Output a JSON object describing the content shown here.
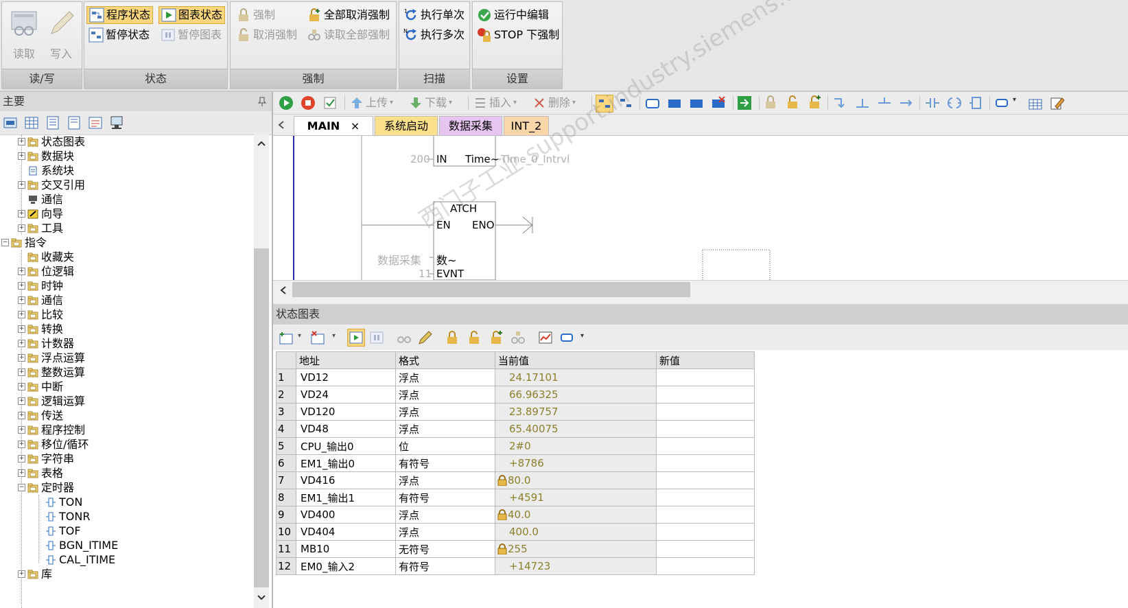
{
  "ribbon": {
    "groups": {
      "rw": "读/写",
      "status": "状态",
      "force": "强制",
      "scan": "扫描",
      "settings": "设置"
    },
    "read": "读取",
    "write": "写入",
    "program_status": "程序状态",
    "chart_status": "图表状态",
    "pause_status": "暂停状态",
    "pause_chart": "暂停图表",
    "force": "强制",
    "unforce": "取消强制",
    "unforce_all": "全部取消强制",
    "read_all_forced": "读取全部强制",
    "single_scan": "执行单次",
    "multiple_scans": "执行多次",
    "run_edit": "运行中编辑",
    "stop_force": "STOP 下强制"
  },
  "left_panel": {
    "title": "主要",
    "pin": "ᵖ",
    "tree": [
      {
        "label": "状态图表",
        "exp": "+"
      },
      {
        "label": "数据块",
        "exp": "+"
      },
      {
        "label": "系统块",
        "exp": ""
      },
      {
        "label": "交叉引用",
        "exp": "+"
      },
      {
        "label": "通信",
        "exp": ""
      },
      {
        "label": "向导",
        "exp": "+"
      },
      {
        "label": "工具",
        "exp": "+"
      },
      {
        "label": "指令",
        "exp": "-"
      },
      {
        "label": "收藏夹",
        "exp": ""
      },
      {
        "label": "位逻辑",
        "exp": "+"
      },
      {
        "label": "时钟",
        "exp": "+"
      },
      {
        "label": "通信",
        "exp": "+"
      },
      {
        "label": "比较",
        "exp": "+"
      },
      {
        "label": "转换",
        "exp": "+"
      },
      {
        "label": "计数器",
        "exp": "+"
      },
      {
        "label": "浮点运算",
        "exp": "+"
      },
      {
        "label": "整数运算",
        "exp": "+"
      },
      {
        "label": "中断",
        "exp": "+"
      },
      {
        "label": "逻辑运算",
        "exp": "+"
      },
      {
        "label": "传送",
        "exp": "+"
      },
      {
        "label": "程序控制",
        "exp": "+"
      },
      {
        "label": "移位/循环",
        "exp": "+"
      },
      {
        "label": "字符串",
        "exp": "+"
      },
      {
        "label": "表格",
        "exp": "+"
      },
      {
        "label": "定时器",
        "exp": "-"
      },
      {
        "label": "TON",
        "exp": ""
      },
      {
        "label": "TONR",
        "exp": ""
      },
      {
        "label": "TOF",
        "exp": ""
      },
      {
        "label": "BGN_ITIME",
        "exp": ""
      },
      {
        "label": "CAL_ITIME",
        "exp": ""
      },
      {
        "label": "库",
        "exp": "+"
      }
    ]
  },
  "editor": {
    "toolbar": {
      "upload": "上传",
      "download": "下载",
      "insert": "插入",
      "delete": "删除"
    },
    "tabs": [
      "MAIN",
      "系统启动",
      "数据采集",
      "INT_2"
    ],
    "tab_close": "×",
    "ladder": {
      "in_value": "200",
      "in_pin": "IN",
      "time_pin": "Time~",
      "time_out": "Time_0_Intrvl",
      "atch_title": "ATCH",
      "en": "EN",
      "eno": "ENO",
      "int_label": "数据采集",
      "int_pin": "数~",
      "evnt_value": "11",
      "evnt_pin": "EVNT"
    }
  },
  "status_chart": {
    "title": "状态图表",
    "columns": [
      "地址",
      "格式",
      "当前值",
      "新值"
    ],
    "rows": [
      {
        "n": "1",
        "addr": "VD12",
        "fmt": "浮点",
        "cur": "24.17101",
        "forced": false
      },
      {
        "n": "2",
        "addr": "VD24",
        "fmt": "浮点",
        "cur": "66.96325",
        "forced": false
      },
      {
        "n": "3",
        "addr": "VD120",
        "fmt": "浮点",
        "cur": "23.89757",
        "forced": false
      },
      {
        "n": "4",
        "addr": "VD48",
        "fmt": "浮点",
        "cur": "65.40075",
        "forced": false
      },
      {
        "n": "5",
        "addr": "CPU_输出0",
        "fmt": "位",
        "cur": "2#0",
        "forced": false
      },
      {
        "n": "6",
        "addr": "EM1_输出0",
        "fmt": "有符号",
        "cur": "+8786",
        "forced": false
      },
      {
        "n": "7",
        "addr": "VD416",
        "fmt": "浮点",
        "cur": "80.0",
        "forced": true
      },
      {
        "n": "8",
        "addr": "EM1_输出1",
        "fmt": "有符号",
        "cur": "+4591",
        "forced": false
      },
      {
        "n": "9",
        "addr": "VD400",
        "fmt": "浮点",
        "cur": "40.0",
        "forced": true
      },
      {
        "n": "10",
        "addr": "VD404",
        "fmt": "浮点",
        "cur": "400.0",
        "forced": false
      },
      {
        "n": "11",
        "addr": "MB10",
        "fmt": "无符号",
        "cur": "255",
        "forced": true
      },
      {
        "n": "12",
        "addr": "EM0_输入2",
        "fmt": "有符号",
        "cur": "+14723",
        "forced": false
      }
    ]
  },
  "watermark": "西门子工业 support.industry.siemens.com/cs   技术论坛",
  "colors": {
    "active_button": "#fbd67c",
    "tab_main": "#ffffff",
    "tab_sys": "#fde08a",
    "tab_data": "#e6c6f0",
    "tab_int": "#fbd6a8",
    "current_value_text": "#8c7f2a"
  }
}
